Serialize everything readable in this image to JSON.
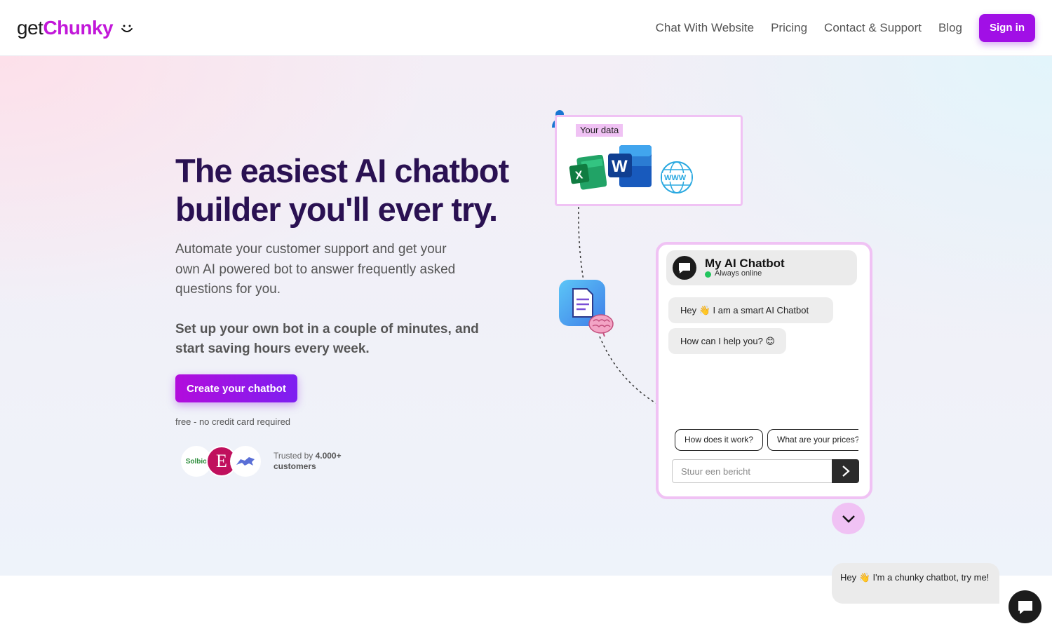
{
  "header": {
    "logo_get": "get",
    "logo_chunky": "Chunky",
    "nav": [
      {
        "label": "Chat With Website"
      },
      {
        "label": "Pricing"
      },
      {
        "label": "Contact & Support"
      },
      {
        "label": "Blog"
      }
    ],
    "signin_label": "Sign in"
  },
  "hero": {
    "headline": "The easiest AI chatbot builder you'll ever try.",
    "subtitle": "Automate your customer support and get your own AI powered bot to answer frequently asked questions for you.",
    "subtitle_bold": "Set up your own bot in a couple of minutes, and start saving hours every week.",
    "cta_label": "Create your chatbot",
    "free_note": "free - no credit card required",
    "trusted_prefix": "Trusted by ",
    "trusted_count": "4.000+",
    "trusted_suffix": "customers",
    "logos": [
      "Solbio",
      "E",
      "wolf-logo"
    ]
  },
  "illustration": {
    "data_label": "Your data",
    "data_icons": [
      "excel-icon",
      "word-icon",
      "globe-www-icon"
    ],
    "chatbot": {
      "title": "My AI Chatbot",
      "status": "Always online",
      "messages": [
        "Hey 👋 I am a smart AI Chatbot",
        "How can I help you? 😊"
      ],
      "suggestions": [
        "How does it work?",
        "What are your prices?"
      ],
      "input_placeholder": "Stuur een bericht"
    }
  },
  "widget": {
    "bubble_text": "Hey 👋 I'm a chunky chatbot, try me!"
  },
  "colors": {
    "brand": "#a10fe6",
    "logo_accent": "#c218d9",
    "headline": "#2a1152",
    "card_border": "#f0c2f4"
  }
}
